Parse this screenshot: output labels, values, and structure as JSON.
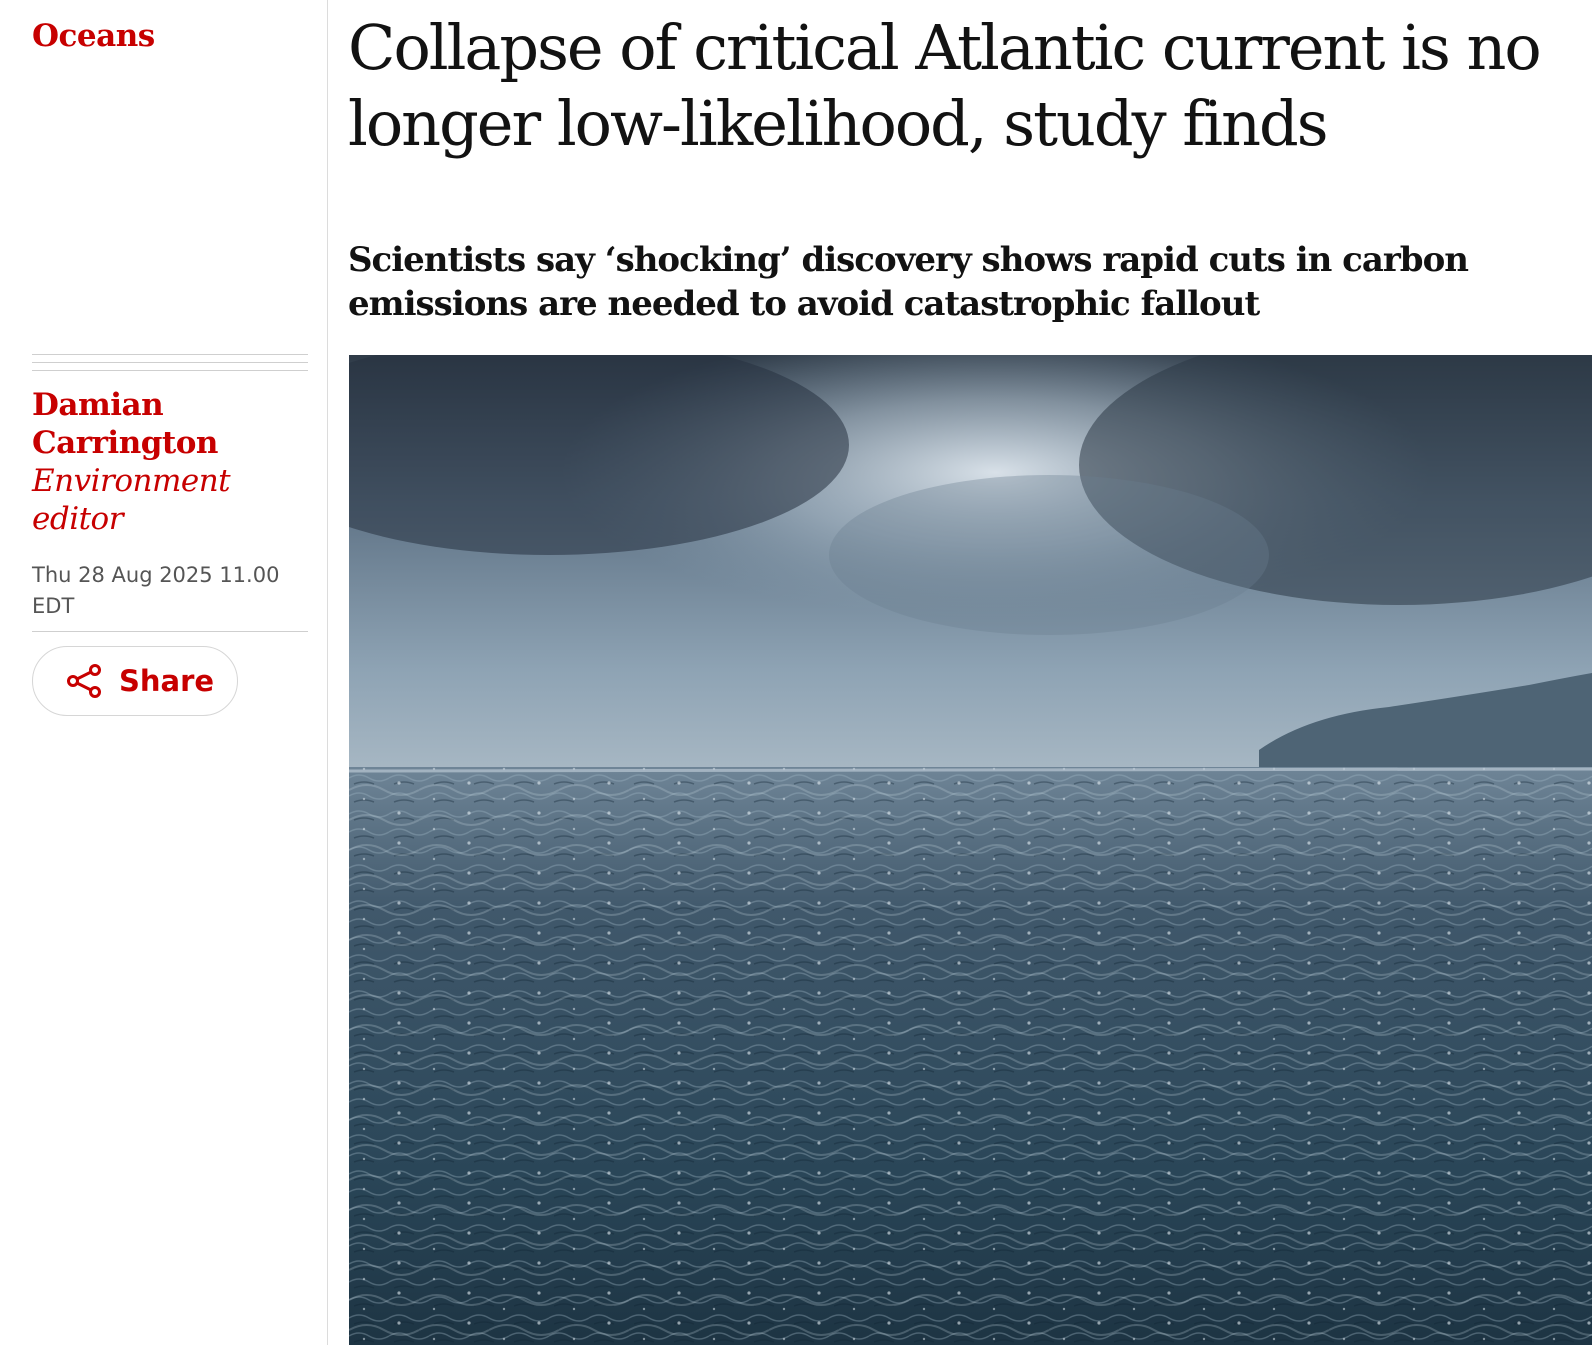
{
  "section": {
    "label": "Oceans"
  },
  "article": {
    "headline": "Collapse of critical Atlantic current is no longer low-likelihood, study finds",
    "standfirst": "Scientists say ‘shocking’ discovery shows rapid cuts in carbon emissions are needed to avoid catastrophic fallout"
  },
  "byline": {
    "author_line1": "Damian",
    "author_line2": "Carrington",
    "role_line1": "Environment",
    "role_line2": "editor"
  },
  "meta": {
    "date_line1": "Thu 28 Aug 2025 11.00",
    "date_line2": "EDT"
  },
  "share": {
    "label": "Share",
    "icon": "share-icon"
  },
  "colors": {
    "accent": "#c70000",
    "text": "#121212",
    "muted": "#555555",
    "rule": "#cfcfcf"
  }
}
